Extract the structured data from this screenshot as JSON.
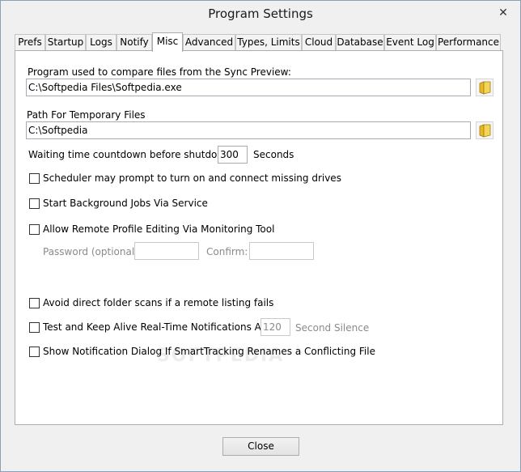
{
  "window": {
    "title": "Program Settings",
    "close_glyph": "✕"
  },
  "tabs": [
    {
      "label": "Prefs"
    },
    {
      "label": "Startup"
    },
    {
      "label": "Logs"
    },
    {
      "label": "Notify"
    },
    {
      "label": "Misc"
    },
    {
      "label": "Advanced"
    },
    {
      "label": "Types, Limits"
    },
    {
      "label": "Cloud"
    },
    {
      "label": "Database"
    },
    {
      "label": "Event Log"
    },
    {
      "label": "Performance"
    }
  ],
  "active_tab": "Misc",
  "misc": {
    "compare_label": "Program used to compare files from the Sync Preview:",
    "compare_value": "C:\\Softpedia Files\\Softpedia.exe",
    "temp_label": "Path For Temporary Files",
    "temp_value": "C:\\Softpedia",
    "wait_label": "Waiting time countdown before shutdown:",
    "wait_value": "300",
    "wait_unit": "Seconds",
    "scheduler_prompt": {
      "label": "Scheduler may prompt to turn on and connect missing drives",
      "checked": false
    },
    "background_jobs": {
      "label": "Start Background Jobs Via Service",
      "checked": false
    },
    "remote_editing": {
      "label": "Allow Remote Profile Editing Via Monitoring Tool",
      "checked": false
    },
    "password_label": "Password (optional):",
    "password_value": "",
    "confirm_label": "Confirm:",
    "confirm_value": "",
    "avoid_scans": {
      "label": "Avoid direct folder scans if a remote listing fails",
      "checked": false
    },
    "keep_alive": {
      "label": "Test and Keep Alive Real-Time Notifications After",
      "checked": false
    },
    "keep_alive_value": "120",
    "keep_alive_unit": "Second Silence",
    "notification_dialog": {
      "label": "Show Notification Dialog If SmartTracking Renames a Conflicting File",
      "checked": false
    }
  },
  "watermark": "SOFTPEDIA",
  "footer": {
    "close_label": "Close"
  },
  "icons": {
    "browse": "folder-icon"
  }
}
